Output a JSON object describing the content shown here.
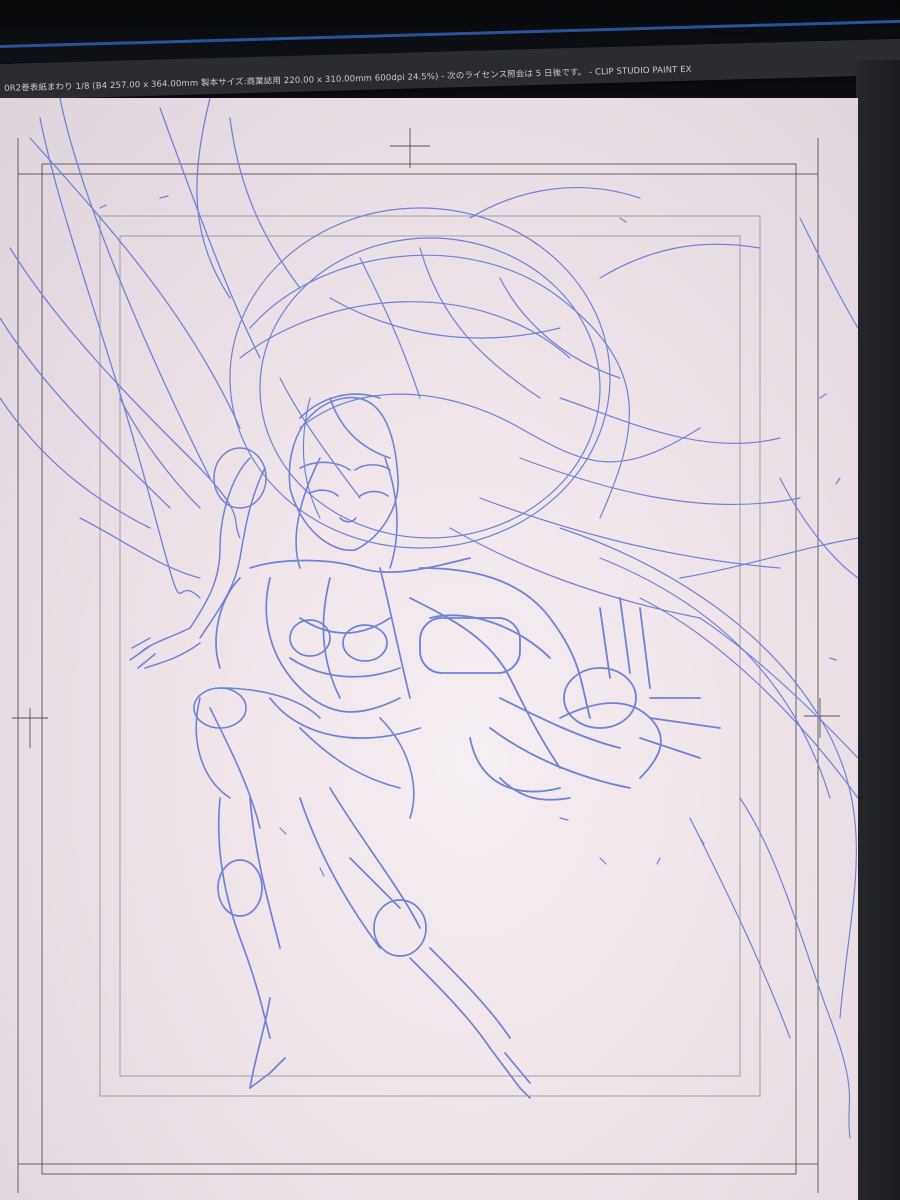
{
  "window": {
    "title": "0R2巻表紙まわり 1/8 (B4 257.00 x 364.00mm 製本サイズ:商業誌用 220.00 x 310.00mm 600dpi 24.5%)  - 次のライセンス照会は 5 日後です。  - CLIP STUDIO PAINT EX",
    "app_name": "CLIP STUDIO PAINT EX",
    "zoom": "24.5%"
  },
  "canvas": {
    "background_color": "#efe4ea",
    "stroke_color": "#6f83d6",
    "content": "rough blue pencil sketch of an armored winged figure"
  },
  "colors": {
    "titlebar": "#2b2c31",
    "accent": "#2d5aa8",
    "sketch": "#6f83d6",
    "bezel": "#0b0c10"
  }
}
